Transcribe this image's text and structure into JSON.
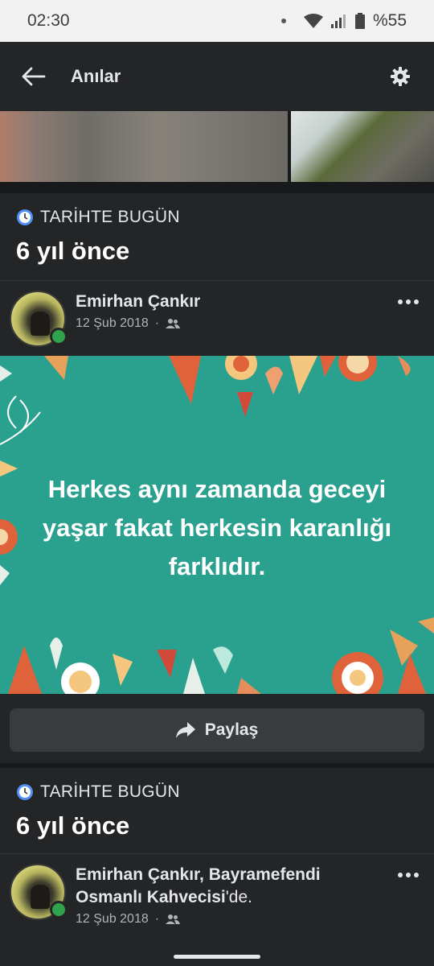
{
  "status_bar": {
    "time": "02:30",
    "battery": "%55"
  },
  "app_bar": {
    "title": "Anılar"
  },
  "memory_sections": [
    {
      "label": "TARİHTE BUGÜN",
      "ago": "6 yıl önce"
    },
    {
      "label": "TARİHTE BUGÜN",
      "ago": "6 yıl önce"
    }
  ],
  "posts": [
    {
      "author": "Emirhan Çankır",
      "date": "12 Şub 2018",
      "quote": "Herkes aynı zamanda geceyi yaşar fakat herkesin karanlığı farklıdır.",
      "share_label": "Paylaş"
    },
    {
      "author_line_1": "Emirhan Çankır, Bayramefendi",
      "author_line_2_place": "Osmanlı Kahvecisi",
      "author_line_2_suffix": "'de.",
      "date": "12 Şub 2018"
    }
  ],
  "colors": {
    "post_bg": "#2aa08e",
    "online": "#31a24c",
    "surface": "#242526"
  }
}
